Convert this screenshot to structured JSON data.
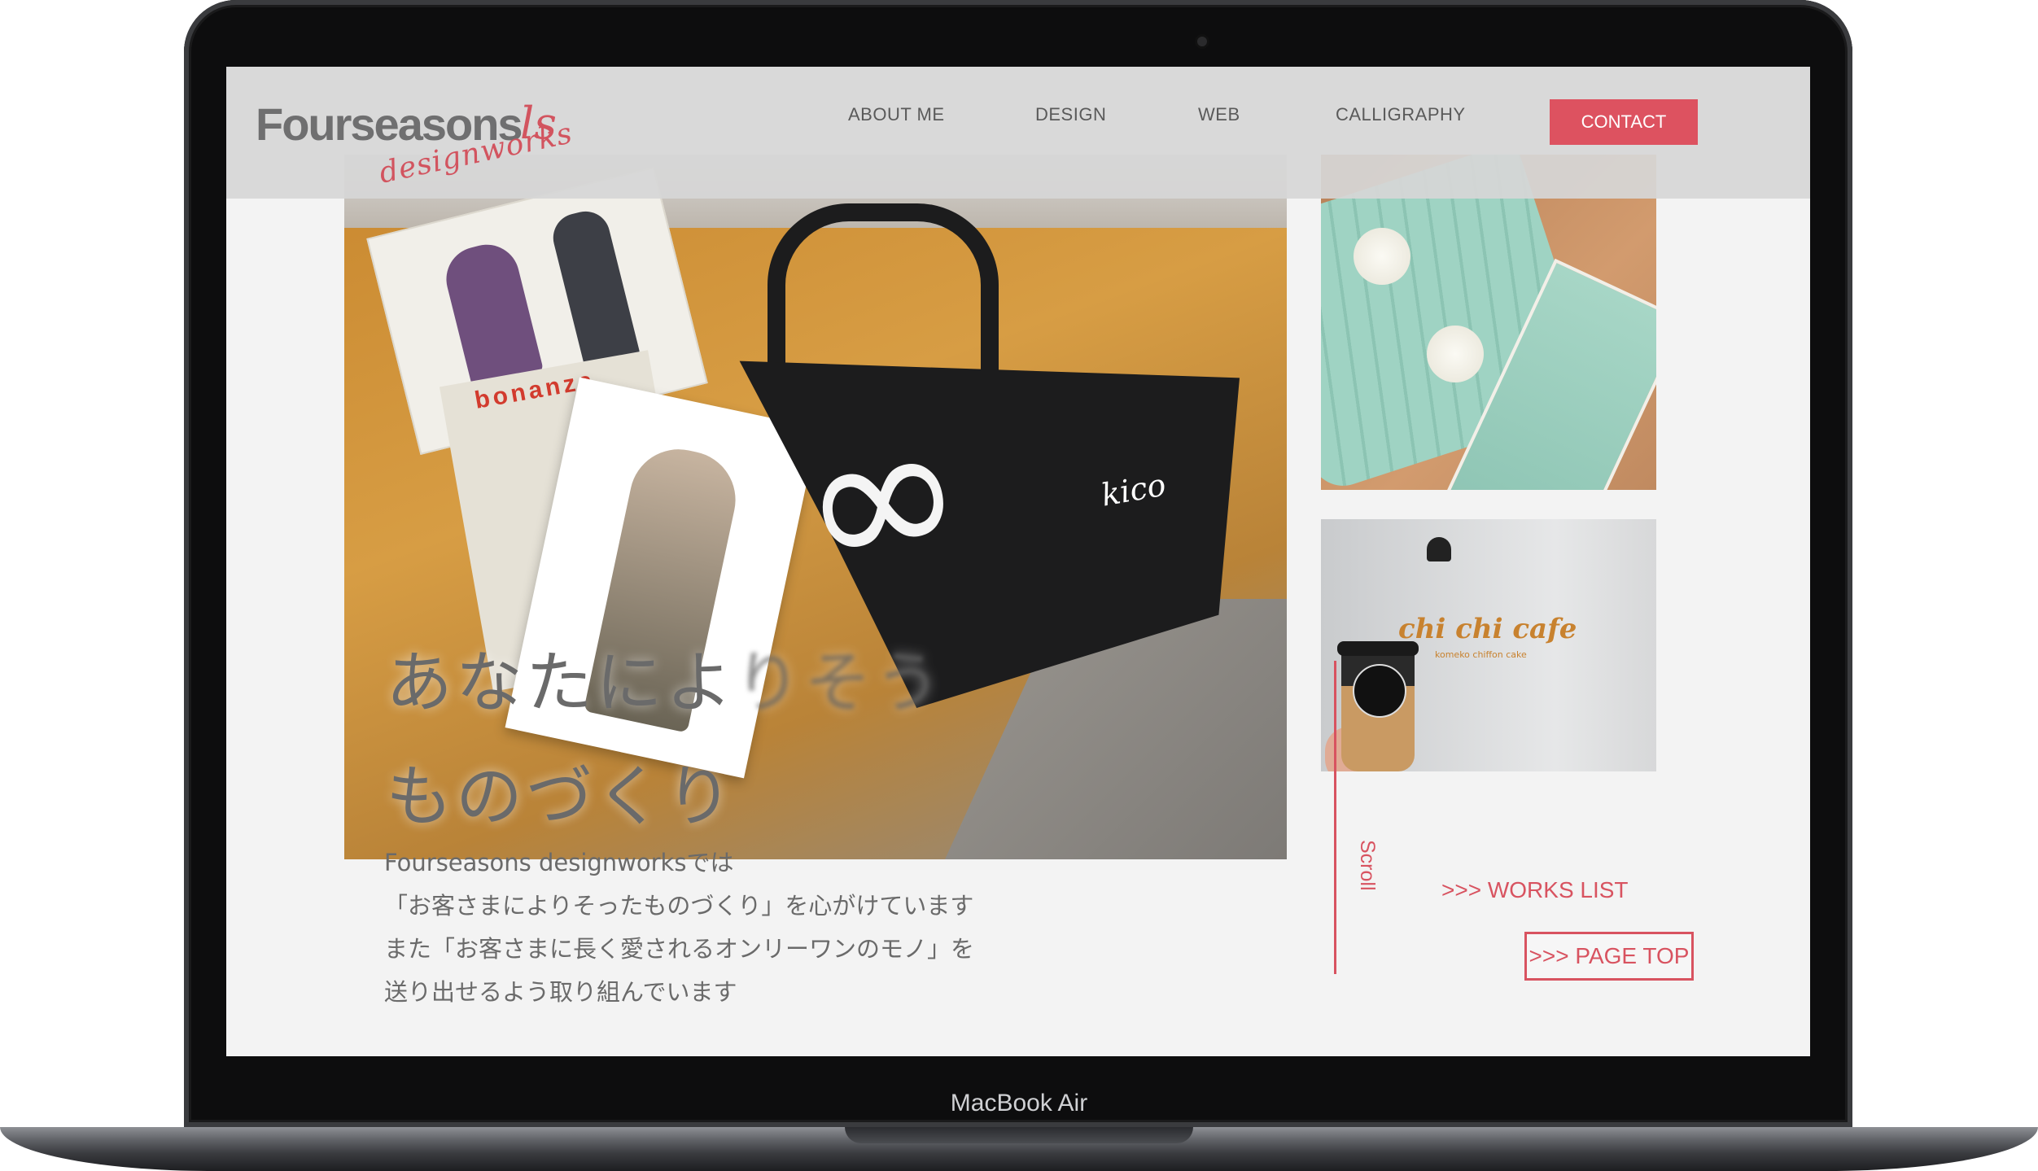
{
  "device": {
    "label": "MacBook Air"
  },
  "site": {
    "logo": {
      "main": "Fourseasons",
      "script": "designworks",
      "swash": "ls"
    },
    "nav": [
      {
        "label": "ABOUT ME"
      },
      {
        "label": "DESIGN"
      },
      {
        "label": "WEB"
      },
      {
        "label": "CALLIGRAPHY"
      }
    ],
    "contact_label": "CONTACT",
    "accent_color": "#dd5260"
  },
  "hero": {
    "line1_a": "あなたによ",
    "line1_b": "りそう",
    "line2": "ものづくり"
  },
  "intro": [
    "Fourseasons designworksでは",
    "「お客さまによりそったものづくり」を心がけています",
    "また「お客さまに長く愛されるオンリーワンのモノ」を",
    "送り出せるよう取り組んでいます"
  ],
  "photos": {
    "main": {
      "magazine_name": "bonanza",
      "tote_text": "kico",
      "symbol": "∞"
    },
    "cafe": {
      "sign": "chi chi cafe",
      "sub": "komeko chiffon cake"
    }
  },
  "side": {
    "scroll_label": "Scroll",
    "works_link": ">>> WORKS LIST",
    "page_top": ">>> PAGE TOP"
  }
}
